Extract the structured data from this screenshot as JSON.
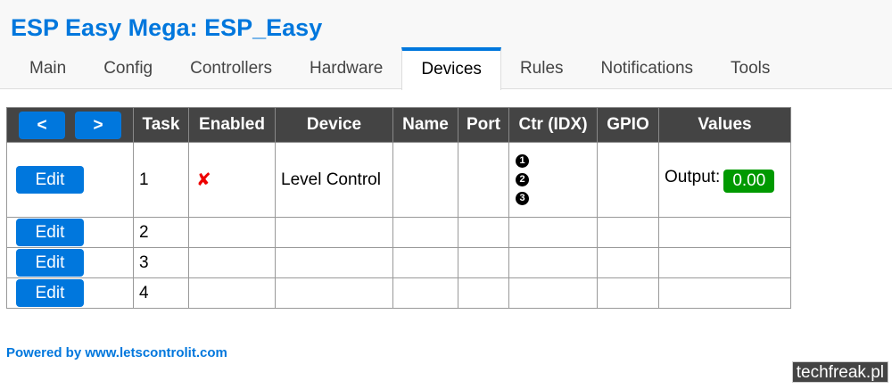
{
  "header": {
    "title": "ESP Easy Mega: ESP_Easy"
  },
  "tabs": [
    {
      "label": "Main",
      "active": false
    },
    {
      "label": "Config",
      "active": false
    },
    {
      "label": "Controllers",
      "active": false
    },
    {
      "label": "Hardware",
      "active": false
    },
    {
      "label": "Devices",
      "active": true
    },
    {
      "label": "Rules",
      "active": false
    },
    {
      "label": "Notifications",
      "active": false
    },
    {
      "label": "Tools",
      "active": false
    }
  ],
  "table": {
    "nav": {
      "prev_label": "<",
      "next_label": ">"
    },
    "columns": [
      "Task",
      "Enabled",
      "Device",
      "Name",
      "Port",
      "Ctr (IDX)",
      "GPIO",
      "Values"
    ],
    "rows": [
      {
        "edit_label": "Edit",
        "task": "1",
        "enabled_mark": "✘",
        "device": "Level Control",
        "name": "",
        "port": "",
        "controllers": [
          "1",
          "2",
          "3"
        ],
        "gpio": "",
        "value_label": "Output:",
        "value": "0.00"
      },
      {
        "edit_label": "Edit",
        "task": "2"
      },
      {
        "edit_label": "Edit",
        "task": "3"
      },
      {
        "edit_label": "Edit",
        "task": "4"
      }
    ]
  },
  "footer": {
    "powered_by": "Powered by www.letscontrolit.com"
  },
  "watermark": "techfreak.pl",
  "colors": {
    "accent": "#0077dd",
    "header_bg": "#444444",
    "value_badge": "#009900",
    "disabled": "#ee0000"
  }
}
